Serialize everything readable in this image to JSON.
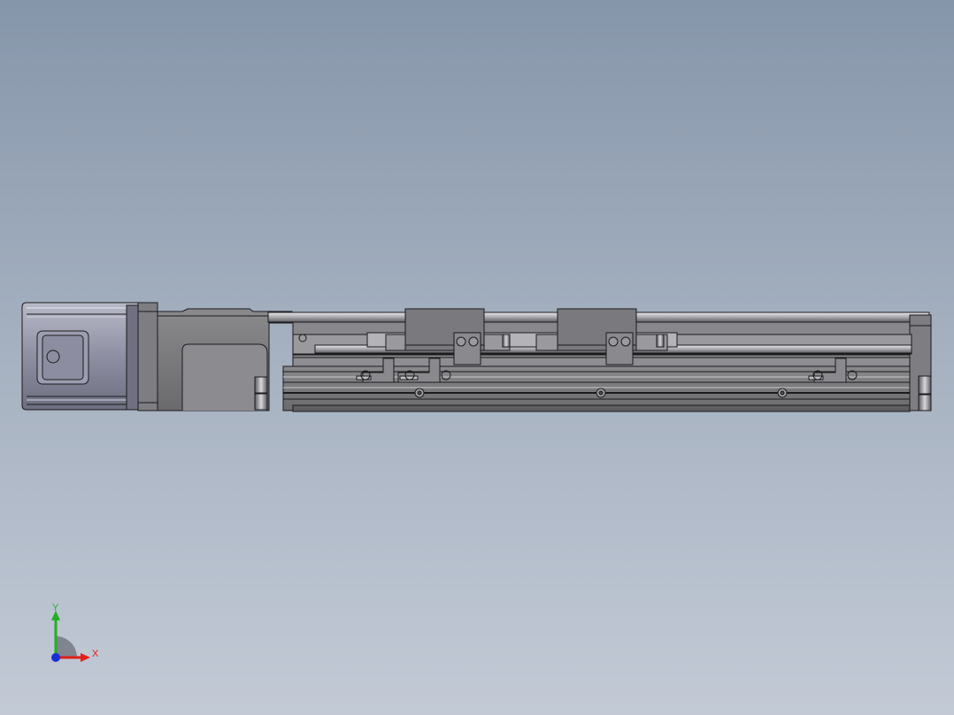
{
  "view": {
    "background_top": "#8696aa",
    "background_bottom": "#c3cad6"
  },
  "model": {
    "part_color": "#7b7b7e",
    "edge_color": "#1b1b1d",
    "highlight_color": "#d9d9dc"
  },
  "triad": {
    "x_label": "X",
    "y_label": "Y",
    "x_color": "#e0201a",
    "y_color": "#22b022",
    "z_color": "#1a2fd6"
  }
}
